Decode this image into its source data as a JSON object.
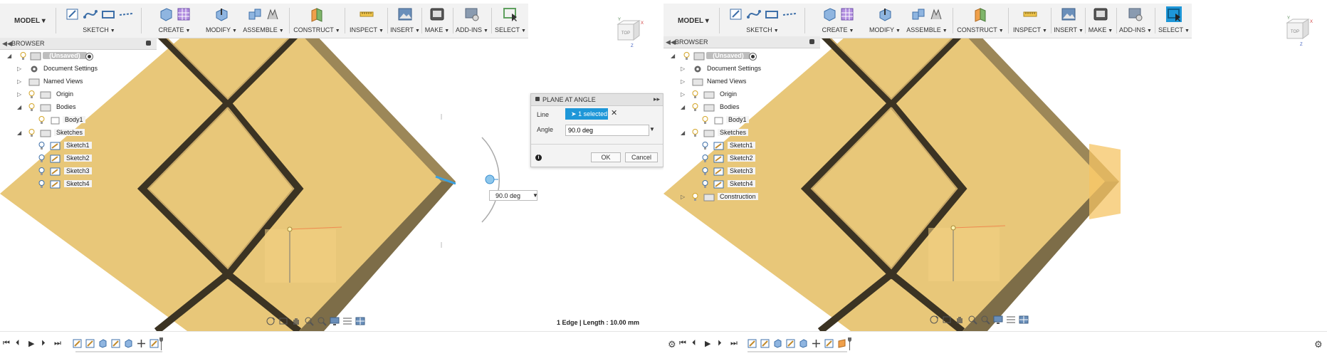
{
  "left": {
    "toolbar": {
      "mode": "MODEL",
      "groups": [
        {
          "id": "sketch",
          "label": "SKETCH"
        },
        {
          "id": "create",
          "label": "CREATE"
        },
        {
          "id": "modify",
          "label": "MODIFY"
        },
        {
          "id": "assemble",
          "label": "ASSEMBLE"
        },
        {
          "id": "construct",
          "label": "CONSTRUCT"
        },
        {
          "id": "inspect",
          "label": "INSPECT"
        },
        {
          "id": "insert",
          "label": "INSERT"
        },
        {
          "id": "make",
          "label": "MAKE"
        },
        {
          "id": "addins",
          "label": "ADD-INS"
        },
        {
          "id": "select",
          "label": "SELECT"
        }
      ]
    },
    "browser": {
      "title": "BROWSER",
      "items": [
        {
          "label": "(Unsaved)"
        },
        {
          "label": "Document Settings"
        },
        {
          "label": "Named Views"
        },
        {
          "label": "Origin"
        },
        {
          "label": "Bodies"
        },
        {
          "label": "Body1"
        },
        {
          "label": "Sketches"
        },
        {
          "label": "Sketch1"
        },
        {
          "label": "Sketch2"
        },
        {
          "label": "Sketch3"
        },
        {
          "label": "Sketch4"
        }
      ]
    },
    "navcube": {
      "face": "TOP",
      "axis_x": "X",
      "axis_y": "Y",
      "axis_z": "Z"
    },
    "dialog": {
      "title": "PLANE AT ANGLE",
      "line_label": "Line",
      "line_value": "1 selected",
      "clear_glyph": "✕",
      "angle_label": "Angle",
      "angle_value": "90.0 deg",
      "ok": "OK",
      "cancel": "Cancel"
    },
    "angle_manipulator_value": "90.0 deg",
    "status": "1 Edge | Length : 10.00 mm"
  },
  "right": {
    "toolbar": {
      "mode": "MODEL",
      "groups": [
        {
          "id": "sketch",
          "label": "SKETCH"
        },
        {
          "id": "create",
          "label": "CREATE"
        },
        {
          "id": "modify",
          "label": "MODIFY"
        },
        {
          "id": "assemble",
          "label": "ASSEMBLE"
        },
        {
          "id": "construct",
          "label": "CONSTRUCT"
        },
        {
          "id": "inspect",
          "label": "INSPECT"
        },
        {
          "id": "insert",
          "label": "INSERT"
        },
        {
          "id": "make",
          "label": "MAKE"
        },
        {
          "id": "addins",
          "label": "ADD-INS"
        },
        {
          "id": "select",
          "label": "SELECT"
        }
      ]
    },
    "browser": {
      "title": "BROWSER",
      "items": [
        {
          "label": "(Unsaved)"
        },
        {
          "label": "Document Settings"
        },
        {
          "label": "Named Views"
        },
        {
          "label": "Origin"
        },
        {
          "label": "Bodies"
        },
        {
          "label": "Body1"
        },
        {
          "label": "Sketches"
        },
        {
          "label": "Sketch1"
        },
        {
          "label": "Sketch2"
        },
        {
          "label": "Sketch3"
        },
        {
          "label": "Sketch4"
        },
        {
          "label": "Construction"
        }
      ]
    },
    "navcube": {
      "face": "TOP",
      "axis_x": "X",
      "axis_y": "Y",
      "axis_z": "Z"
    }
  },
  "colors": {
    "body_face": "#e8c779",
    "groove": "#3a3322",
    "side_shadow": "#8a7a55",
    "accent_blue": "#1e97d8",
    "plane_preview": "#f5cf7a"
  }
}
